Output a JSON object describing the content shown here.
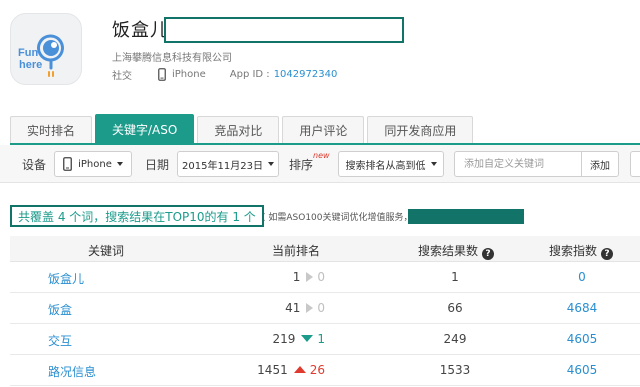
{
  "app": {
    "icon_text": [
      "Fun",
      "here"
    ],
    "title": "饭盒儿",
    "company": "上海攀腾信息科技有限公司",
    "category": "社交",
    "platform": "iPhone",
    "app_id_label": "App ID :",
    "app_id": "1042972340"
  },
  "tabs": [
    {
      "label": "实时排名",
      "active": false
    },
    {
      "label": "关键字/ASO",
      "active": true
    },
    {
      "label": "竞品对比",
      "active": false
    },
    {
      "label": "用户评论",
      "active": false
    },
    {
      "label": "同开发商应用",
      "active": false
    }
  ],
  "filters": {
    "device_label": "设备",
    "device_value": "iPhone",
    "date_label": "日期",
    "date_value": "2015年11月23日",
    "sort_label": "排序",
    "sort_badge": "new",
    "sort_value": "搜索排名从高到低",
    "keyword_placeholder": "添加自定义关键词",
    "add_label": "添加"
  },
  "summary": {
    "text": "共覆盖 4 个词，搜索结果在TOP10的有 1 个",
    "note": "( 如需ASO100关键词优化增值服务，"
  },
  "table": {
    "headers": {
      "keyword": "关键词",
      "rank": "当前排名",
      "results": "搜索结果数",
      "index": "搜索指数"
    },
    "rows": [
      {
        "keyword": "饭盒儿",
        "rank": "1",
        "change": "0",
        "dir": "flat",
        "results": "1",
        "index": "0"
      },
      {
        "keyword": "饭盒",
        "rank": "41",
        "change": "0",
        "dir": "flat",
        "results": "66",
        "index": "4684"
      },
      {
        "keyword": "交互",
        "rank": "219",
        "change": "1",
        "dir": "down",
        "results": "249",
        "index": "4605"
      },
      {
        "keyword": "路况信息",
        "rank": "1451",
        "change": "26",
        "dir": "up",
        "results": "1533",
        "index": "4605"
      }
    ]
  },
  "colors": {
    "accent": "#1c9b8b",
    "link": "#2a8fd0",
    "up": "#e03a2e",
    "highlight_border": "#127369"
  }
}
